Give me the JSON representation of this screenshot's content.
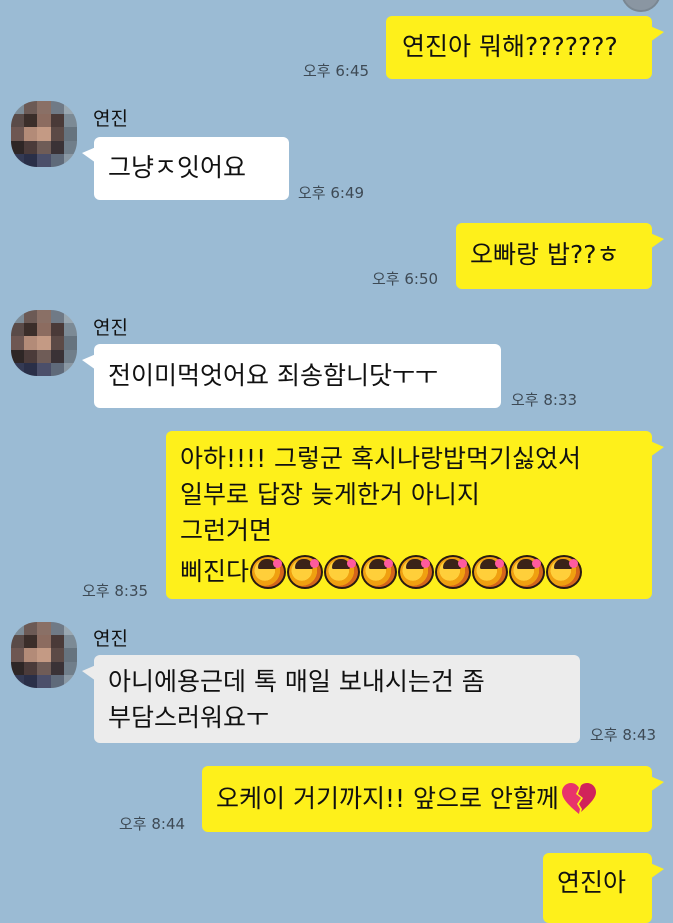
{
  "sender_name": "연진",
  "messages": [
    {
      "from": "me",
      "text": "연진아 뭐해???????",
      "time": "오후 6:45"
    },
    {
      "from": "other",
      "text": "그냥ㅈ잇어요",
      "time": "오후 6:49"
    },
    {
      "from": "me",
      "text": "오빠랑 밥??ㅎ",
      "time": "오후 6:50"
    },
    {
      "from": "other",
      "text": "전이미먹엇어요 죄송함니닷ㅜㅜ",
      "time": "오후 8:33"
    },
    {
      "from": "me",
      "text": "아하!!!! 그렇군 혹시나랑밥먹기싫었서\n일부로 답장  늦게한거 아니지\n그런거면",
      "text_last": "삐진다",
      "time": "오후 8:35",
      "emoji_count": 9
    },
    {
      "from": "other",
      "text": "아니에용근데 톡 매일 보내시는건 좀\n부담스러워요ㅜ",
      "time": "오후 8:43"
    },
    {
      "from": "me",
      "text": "오케이 거기까지!! 앞으로 안할께",
      "time": "오후 8:44",
      "emoji": "broken-heart"
    },
    {
      "from": "me",
      "text": "연진아",
      "time": ""
    }
  ],
  "colors": {
    "background": "#9bbbd4",
    "my_bubble": "#fef01b",
    "other_bubble": "#ffffff"
  }
}
